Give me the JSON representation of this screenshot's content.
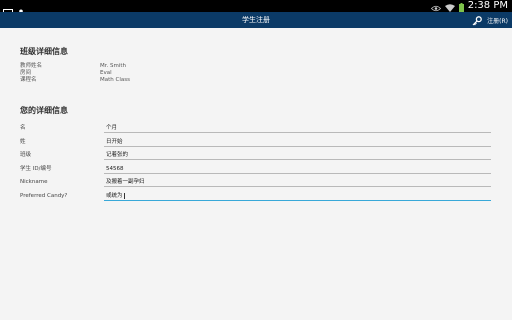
{
  "status_bar": {
    "time": "2:38 PM",
    "icons": [
      "gallery-icon",
      "person-icon",
      "eye-icon",
      "wifi-icon",
      "battery-icon"
    ]
  },
  "app_bar": {
    "title": "学生注册",
    "action_label": "注册(R)",
    "action_icon": "key-icon"
  },
  "class_details": {
    "heading": "班级详细信息",
    "rows": [
      {
        "label": "教师姓名",
        "value": "Mr. Smith"
      },
      {
        "label": "房间",
        "value": "Eval"
      },
      {
        "label": "课程名",
        "value": "Math Class"
      }
    ]
  },
  "your_details": {
    "heading": "您的详细信息",
    "fields": [
      {
        "label": "名",
        "value": "个月"
      },
      {
        "label": "姓",
        "value": "日开始"
      },
      {
        "label": "班级",
        "value": "记着张的"
      },
      {
        "label": "学生 ID/编号",
        "value": "54568"
      },
      {
        "label": "Nickname",
        "value": "及搬着一副孕妇"
      },
      {
        "label": "Preferred Candy?",
        "value": "或统为"
      }
    ]
  },
  "colors": {
    "app_bar": "#0b3a66",
    "focus_underline": "#38a8d8",
    "battery": "#7ec24a"
  }
}
